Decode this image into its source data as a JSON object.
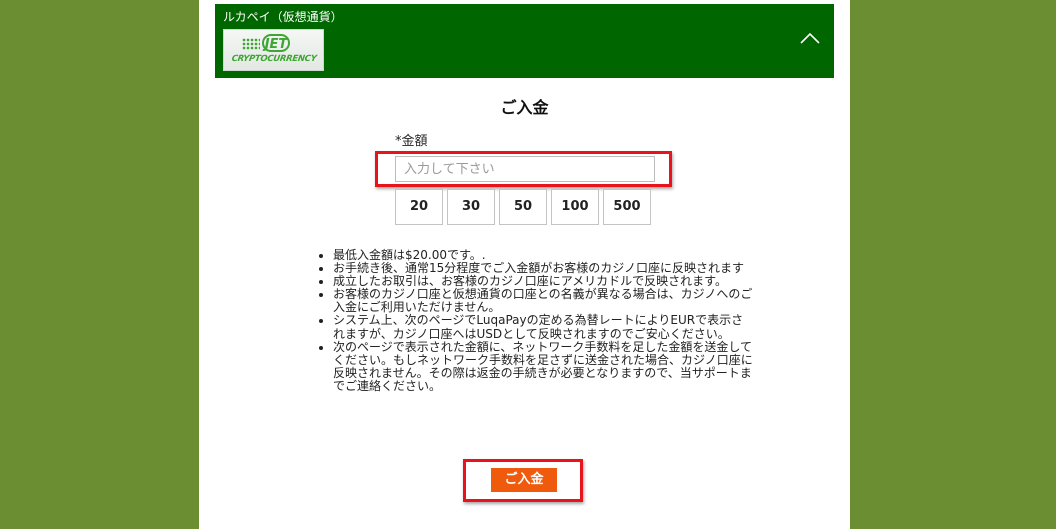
{
  "header": {
    "title": "ルカペイ（仮想通貨）",
    "logo": {
      "icon": "jet-cryptocurrency-logo",
      "main_text": "JET",
      "sub_text": "CRYPTOCURRENCY"
    },
    "collapse_icon": "chevron-up-icon"
  },
  "form": {
    "title": "ご入金",
    "amount_label": "*金額",
    "amount_placeholder": "入力して下さい",
    "amount_value": "",
    "presets": [
      "20",
      "30",
      "50",
      "100",
      "500"
    ]
  },
  "notes": [
    "最低入金額は$20.00です。.",
    "お手続き後、通常15分程度でご入金額がお客様のカジノ口座に反映されます",
    "成立したお取引は、お客様のカジノ口座にアメリカドルで反映されます。",
    "お客様のカジノ口座と仮想通貨の口座との名義が異なる場合は、カジノへのご入金にご利用いただけません。",
    "システム上、次のページでLuqaPayの定める為替レートによりEURで表示されますが、カジノ口座へはUSDとして反映されますのでご安心ください。",
    "次のページで表示された金額に、ネットワーク手数料を足した金額を送金してください。もしネットワーク手数料を足さずに送金された場合、カジノ口座に反映されません。その際は返金の手続きが必要となりますので、当サポートまでご連絡ください。"
  ],
  "submit_label": "ご入金",
  "colors": {
    "background": "#6b8e32",
    "header": "#006600",
    "submit": "#f05a0c",
    "highlight": "#e8141c"
  }
}
